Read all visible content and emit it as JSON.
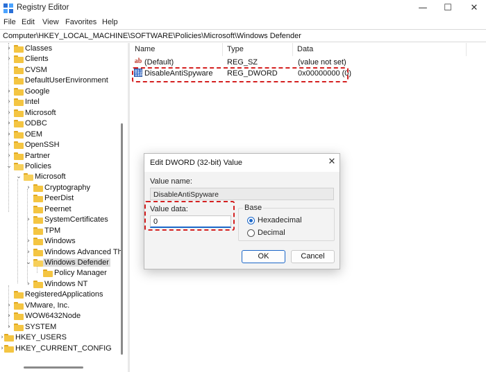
{
  "window": {
    "title": "Registry Editor",
    "min_glyph": "—",
    "max_glyph": "☐",
    "close_glyph": "✕"
  },
  "menu": [
    "File",
    "Edit",
    "View",
    "Favorites",
    "Help"
  ],
  "address": "Computer\\HKEY_LOCAL_MACHINE\\SOFTWARE\\Policies\\Microsoft\\Windows Defender",
  "tree": [
    {
      "label": "Classes",
      "level": 1,
      "chevron": "›",
      "open": false
    },
    {
      "label": "Clients",
      "level": 1,
      "chevron": "›",
      "open": false
    },
    {
      "label": "CVSM",
      "level": 1,
      "chevron": "",
      "open": false
    },
    {
      "label": "DefaultUserEnvironment",
      "level": 1,
      "chevron": "",
      "open": false
    },
    {
      "label": "Google",
      "level": 1,
      "chevron": "›",
      "open": false
    },
    {
      "label": "Intel",
      "level": 1,
      "chevron": "›",
      "open": false
    },
    {
      "label": "Microsoft",
      "level": 1,
      "chevron": "›",
      "open": false
    },
    {
      "label": "ODBC",
      "level": 1,
      "chevron": "›",
      "open": false
    },
    {
      "label": "OEM",
      "level": 1,
      "chevron": "›",
      "open": false
    },
    {
      "label": "OpenSSH",
      "level": 1,
      "chevron": "›",
      "open": false
    },
    {
      "label": "Partner",
      "level": 1,
      "chevron": "›",
      "open": false
    },
    {
      "label": "Policies",
      "level": 1,
      "chevron": "⌄",
      "open": true
    },
    {
      "label": "Microsoft",
      "level": 2,
      "chevron": "⌄",
      "open": true
    },
    {
      "label": "Cryptography",
      "level": 3,
      "chevron": "›",
      "open": false
    },
    {
      "label": "PeerDist",
      "level": 3,
      "chevron": "",
      "open": false
    },
    {
      "label": "Peernet",
      "level": 3,
      "chevron": "",
      "open": false
    },
    {
      "label": "SystemCertificates",
      "level": 3,
      "chevron": "›",
      "open": false
    },
    {
      "label": "TPM",
      "level": 3,
      "chevron": "",
      "open": false
    },
    {
      "label": "Windows",
      "level": 3,
      "chevron": "›",
      "open": false
    },
    {
      "label": "Windows Advanced Th",
      "level": 3,
      "chevron": "›",
      "open": false
    },
    {
      "label": "Windows Defender",
      "level": 3,
      "chevron": "⌄",
      "open": true,
      "selected": true
    },
    {
      "label": "Policy Manager",
      "level": 4,
      "chevron": "",
      "open": false
    },
    {
      "label": "Windows NT",
      "level": 3,
      "chevron": "›",
      "open": false
    },
    {
      "label": "RegisteredApplications",
      "level": 1,
      "chevron": "",
      "open": false
    },
    {
      "label": "VMware, Inc.",
      "level": 1,
      "chevron": "›",
      "open": false
    },
    {
      "label": "WOW6432Node",
      "level": 1,
      "chevron": "›",
      "open": false
    },
    {
      "label": "SYSTEM",
      "level": 0,
      "chevron": "›",
      "open": false
    },
    {
      "label": "HKEY_USERS",
      "level": -1,
      "chevron": "›",
      "open": false
    },
    {
      "label": "HKEY_CURRENT_CONFIG",
      "level": -1,
      "chevron": "›",
      "open": false
    }
  ],
  "values_pane": {
    "headers": {
      "name": "Name",
      "type": "Type",
      "data": "Data"
    },
    "rows": [
      {
        "name": "(Default)",
        "type": "REG_SZ",
        "data": "(value not set)",
        "icon": "string-value-icon",
        "icon_glyph": "ab"
      },
      {
        "name": "DisableAntiSpyware",
        "type": "REG_DWORD",
        "data": "0x00000000 (0)",
        "icon": "binary-value-icon",
        "icon_glyph": "011\n110"
      }
    ]
  },
  "dialog": {
    "title": "Edit DWORD (32-bit) Value",
    "close_glyph": "✕",
    "value_name_label": "Value name:",
    "value_name": "DisableAntiSpyware",
    "value_data_label": "Value data:",
    "value_data": "0",
    "base_label": "Base",
    "base_options": [
      {
        "label": "Hexadecimal",
        "checked": true
      },
      {
        "label": "Decimal",
        "checked": false
      }
    ],
    "ok_label": "OK",
    "cancel_label": "Cancel"
  },
  "colors": {
    "highlight": "#d42020",
    "accent": "#1a66c8",
    "folder": "#f4c542"
  }
}
